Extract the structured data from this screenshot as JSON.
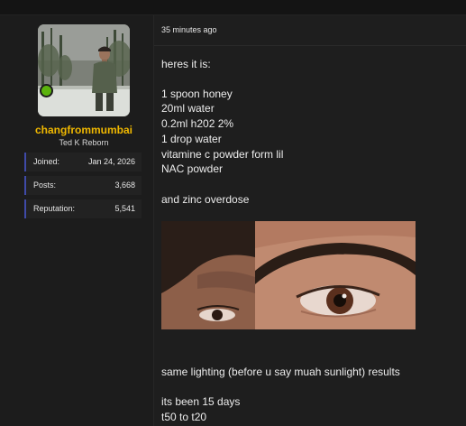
{
  "user": {
    "username": "changfrommumbai",
    "title": "Ted K Reborn",
    "avatar_icon": "user-avatar-photo",
    "online": true,
    "stats": [
      {
        "label": "Joined:",
        "value": "Jan 24, 2026"
      },
      {
        "label": "Posts:",
        "value": "3,668"
      },
      {
        "label": "Reputation:",
        "value": "5,541"
      }
    ]
  },
  "post": {
    "timestamp": "35 minutes ago",
    "lines": [
      "heres it is:",
      "1 spoon honey",
      "20ml water",
      "0.2ml h202 2%",
      "1 drop water",
      "vitamine c powder form lil",
      "NAC powder",
      "and zinc overdose",
      "same lighting (before u say muah sunlight) results",
      "its been 15 days",
      "t50 to t20"
    ],
    "image_icon": "eye-comparison-photo"
  },
  "colors": {
    "username": "#f0b800",
    "online": "#5bb30d",
    "stat_accent": "#3f4aa8"
  }
}
